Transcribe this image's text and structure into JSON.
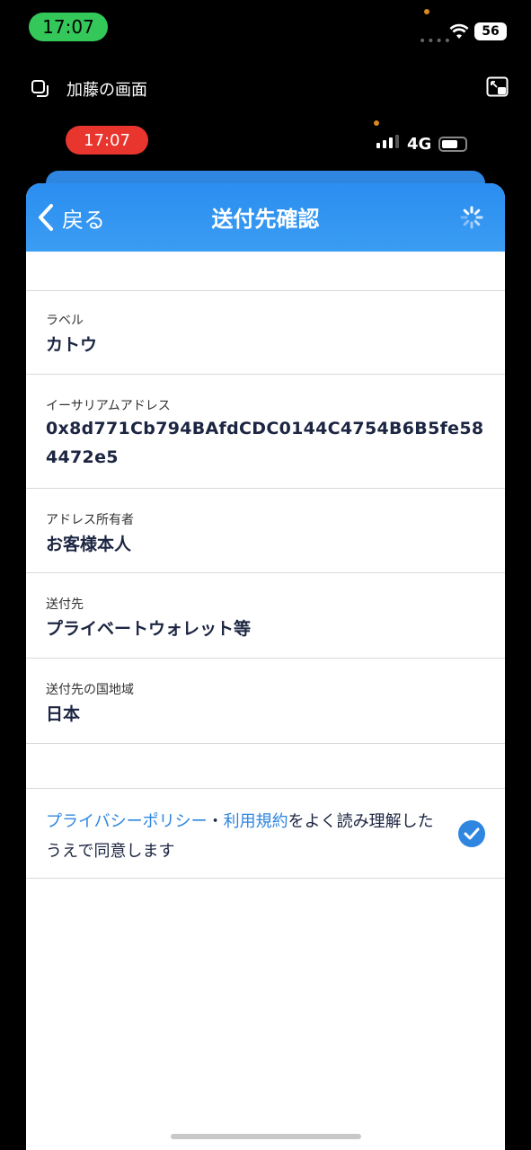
{
  "outer_status": {
    "time": "17:07",
    "battery": "56"
  },
  "share_bar": {
    "title": "加藤の画面"
  },
  "inner_status": {
    "time": "17:07",
    "network": "4G"
  },
  "nav": {
    "back_label": "戻る",
    "title": "送付先確認"
  },
  "fields": [
    {
      "label": "ラベル",
      "value": "カトウ"
    },
    {
      "label": "イーサリアムアドレス",
      "value": "0x8d771Cb794BAfdCDC0144C4754B6B5fe584472e5"
    },
    {
      "label": "アドレス所有者",
      "value": "お客様本人"
    },
    {
      "label": "送付先",
      "value": "プライベートウォレット等"
    },
    {
      "label": "送付先の国地域",
      "value": "日本"
    }
  ],
  "consent": {
    "privacy_link": "プライバシーポリシー",
    "separator": "・",
    "terms_link": "利用規約",
    "text_after": "をよく読み理解したうえで同意します",
    "checked": true
  },
  "colors": {
    "accent": "#2f86e0",
    "nav_gradient_top": "#2b8ef0",
    "record_pill": "#e8352e",
    "share_pill": "#34c759"
  }
}
